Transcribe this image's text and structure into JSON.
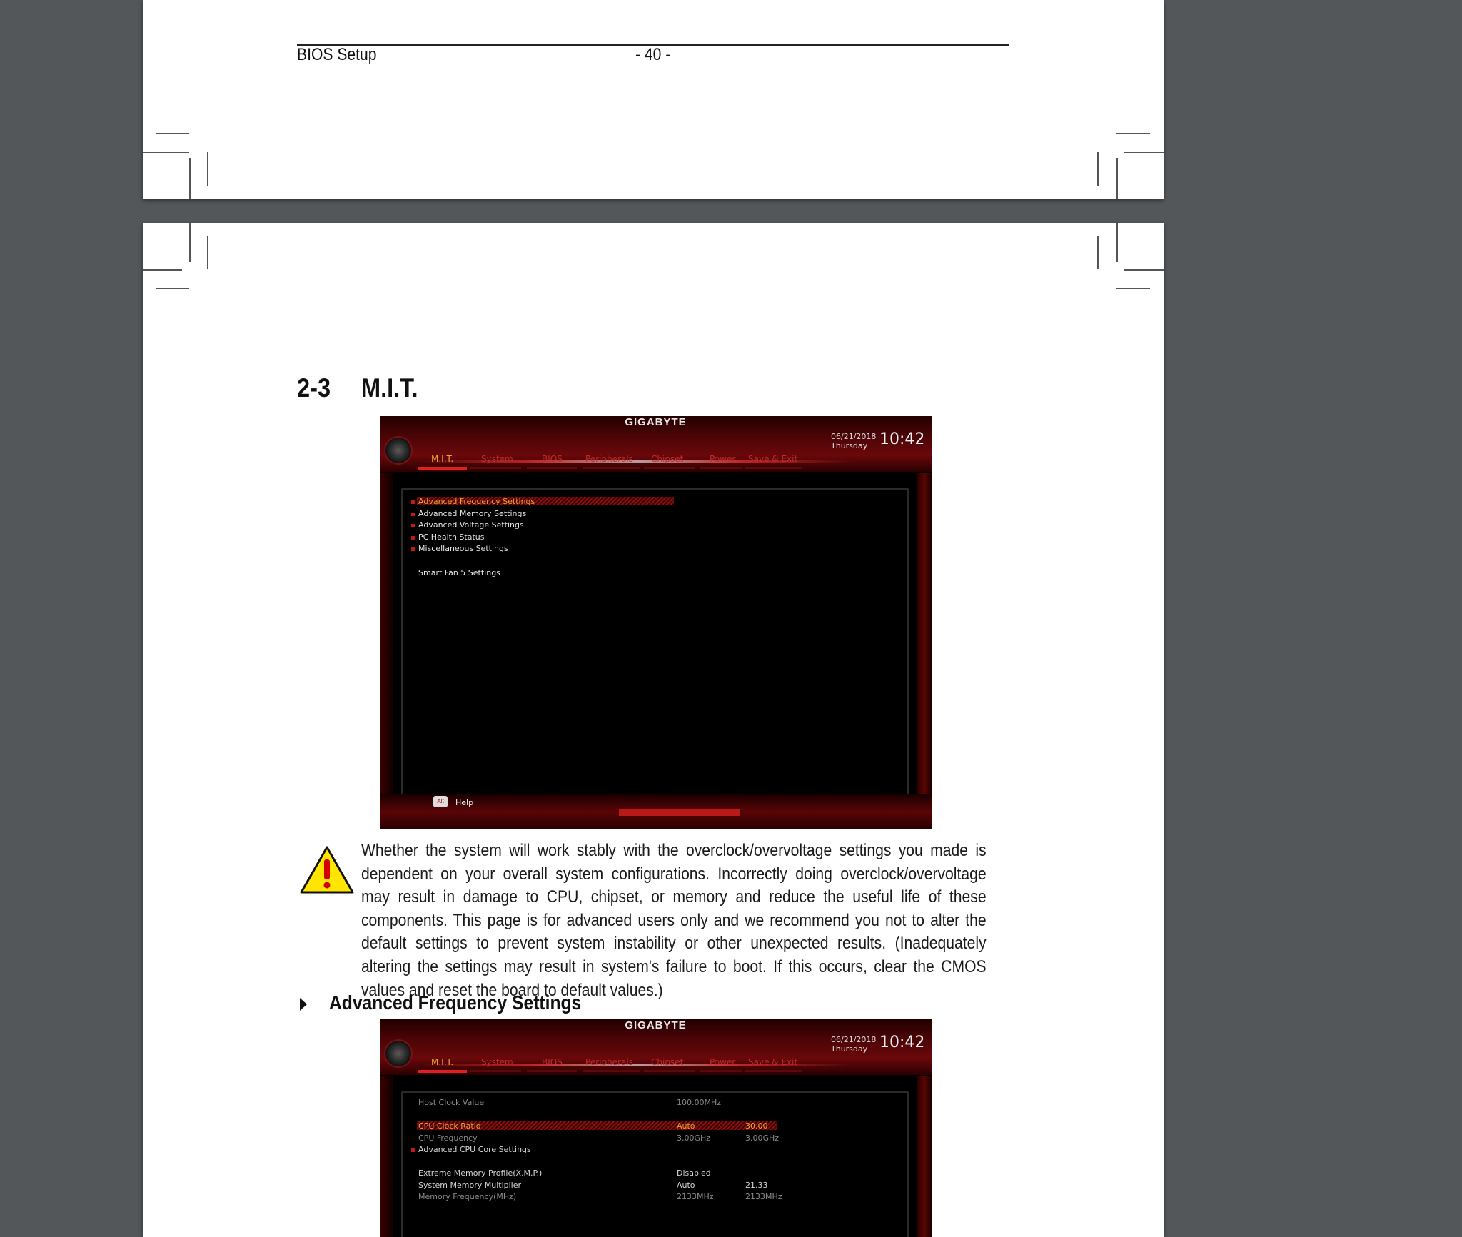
{
  "page_header": {
    "section_label": "BIOS Setup",
    "page_number": "- 40 -"
  },
  "section": {
    "number": "2-3",
    "title": "M.I.T."
  },
  "bios_common": {
    "brand": "GIGABYTE",
    "date": "06/21/2018",
    "day": "Thursday",
    "time": "10:42",
    "tabs": [
      "M.I.T.",
      "System",
      "BIOS",
      "Peripherals",
      "Chipset",
      "Power",
      "Save & Exit"
    ],
    "active_tab": "M.I.T.",
    "help_key": "Alt",
    "help_label": "Help"
  },
  "bios_main_menu": {
    "items": [
      {
        "label": "Advanced Frequency Settings",
        "highlighted": true,
        "bullet": true
      },
      {
        "label": "Advanced Memory Settings",
        "highlighted": false,
        "bullet": true
      },
      {
        "label": "Advanced Voltage Settings",
        "highlighted": false,
        "bullet": true
      },
      {
        "label": "PC Health Status",
        "highlighted": false,
        "bullet": true
      },
      {
        "label": "Miscellaneous Settings",
        "highlighted": false,
        "bullet": true
      },
      {
        "label": "Smart Fan 5 Settings",
        "highlighted": false,
        "bullet": false
      }
    ]
  },
  "warning": {
    "text": "Whether the system will work stably with the overclock/overvoltage settings you made is dependent on your overall system configurations. Incorrectly doing overclock/overvoltage may result in damage to CPU, chipset, or memory and reduce the useful life of these components. This page is for advanced users only and we recommend you not to alter the default settings to prevent system instability or other unexpected results. (Inadequately altering the settings may result in system's failure to boot. If this occurs, clear the CMOS values and reset the board to default values.)"
  },
  "subsection": {
    "title": "Advanced Frequency Settings"
  },
  "bios_freq_settings": {
    "rows": [
      {
        "label": "Host Clock Value",
        "value": "100.00MHz",
        "current": "",
        "style": "dim"
      },
      {
        "label": "CPU Clock Ratio",
        "value": "Auto",
        "current": "30.00",
        "style": "hl"
      },
      {
        "label": "CPU Frequency",
        "value": "3.00GHz",
        "current": "3.00GHz",
        "style": "dim"
      },
      {
        "label": "Advanced CPU Core Settings",
        "value": "",
        "current": "",
        "style": "bullet"
      },
      {
        "label": "Extreme Memory Profile(X.M.P.)",
        "value": "Disabled",
        "current": "",
        "style": "normal"
      },
      {
        "label": "System Memory Multiplier",
        "value": "Auto",
        "current": "21.33",
        "style": "normal"
      },
      {
        "label": "Memory Frequency(MHz)",
        "value": "2133MHz",
        "current": "2133MHz",
        "style": "dim"
      }
    ]
  }
}
